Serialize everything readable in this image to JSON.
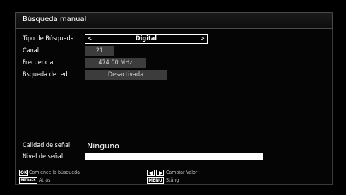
{
  "window": {
    "title": "Búsqueda manual"
  },
  "fields": {
    "search_type": {
      "label": "Tipo de Búsqueda",
      "value": "Digital",
      "prev_symbol": "<",
      "next_symbol": ">"
    },
    "channel": {
      "label": "Canal",
      "value": "21"
    },
    "frequency": {
      "label": "Frecuencia",
      "value": "474.00 MHz"
    },
    "network_search": {
      "label": "Bsqueda de red",
      "value": "Desactivada"
    }
  },
  "signal": {
    "quality_label": "Calidad de señal:",
    "quality_value": "Ninguno",
    "level_label": "Nivel de señal:",
    "level_fraction": 1.0
  },
  "footer": {
    "ok": {
      "key": "OK",
      "label": "Comience la búsqueda"
    },
    "back": {
      "key": "RETBACK",
      "label": "Atrás"
    },
    "lr": {
      "label": "Cambiar Valor",
      "icons": [
        "arrow-left-icon",
        "arrow-right-icon"
      ]
    },
    "menu": {
      "key": "MENU",
      "label": "Stäng"
    }
  }
}
